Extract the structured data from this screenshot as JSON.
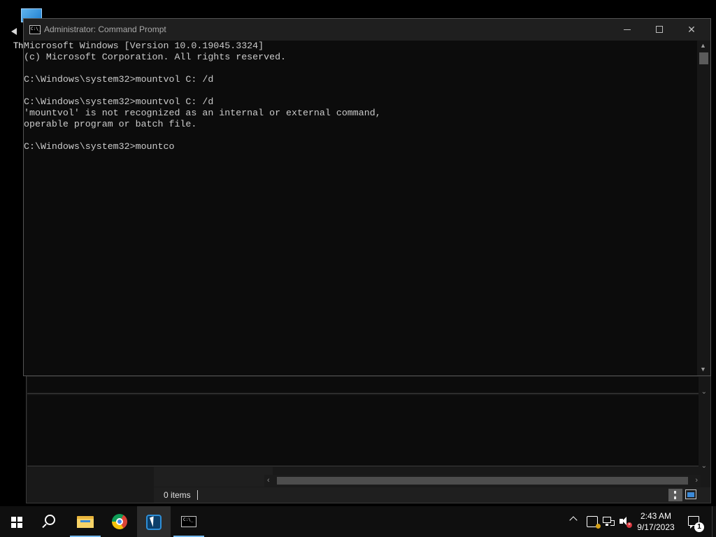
{
  "desktop": {
    "icon_label": "Th"
  },
  "cmd": {
    "title": "Administrator: Command Prompt",
    "icon_glyph": "C:\\_",
    "lines": [
      "Microsoft Windows [Version 10.0.19045.3324]",
      "(c) Microsoft Corporation. All rights reserved.",
      "",
      "C:\\Windows\\system32>mountvol C: /d",
      "",
      "C:\\Windows\\system32>mountvol C: /d",
      "'mountvol' is not recognized as an internal or external command,",
      "operable program or batch file.",
      "",
      "C:\\Windows\\system32>mountco"
    ],
    "close_glyph": "✕"
  },
  "explorer": {
    "status_text": "0 items"
  },
  "taskbar": {
    "time": "2:43 AM",
    "date": "9/17/2023",
    "notification_count": "1",
    "vol_mute_glyph": "×",
    "term_glyph": "C:\\_"
  },
  "colors": {
    "console_bg": "#0c0c0c",
    "console_fg": "#cccccc",
    "taskbar_bg": "#0f0f0f",
    "accent": "#76b9ed"
  }
}
